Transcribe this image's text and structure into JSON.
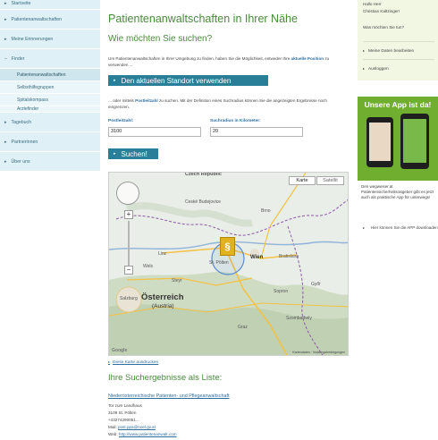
{
  "sidebar": {
    "items": [
      {
        "label": "Startseite",
        "arrow": "▸"
      },
      {
        "label": "Patientenanwaltschaften",
        "arrow": "▸"
      },
      {
        "label": "Meine Erinnerungen",
        "arrow": "▸"
      },
      {
        "label": "Finder",
        "arrow": "–"
      }
    ],
    "subitems": [
      {
        "label": "Patientenanwaltschaften"
      },
      {
        "label": "Selbsthilfegruppen"
      },
      {
        "label": "Spitalskompass"
      },
      {
        "label": "Ärztefinder"
      }
    ],
    "items_after": [
      {
        "label": "Tagebuch",
        "arrow": "▸"
      },
      {
        "label": "Partnerinnen",
        "arrow": "▸"
      },
      {
        "label": "Über uns",
        "arrow": "▸"
      }
    ]
  },
  "main": {
    "title": "Patientenanwaltschaften in Ihrer Nähe",
    "subtitle": "Wie möchten Sie suchen?",
    "intro_pre": "Um Patientenanwaltschaften in Ihrer Umgebung zu finden, haben Sie die Möglichkeit, entweder Ihre",
    "intro_bold": "aktuelle Position",
    "intro_post": "zu verwenden ...",
    "location_button": "Den aktuellen Standort verwenden",
    "intro2_pre": "... oder mittels",
    "intro2_bold": "Postleitzahl",
    "intro2_post": "zu suchen. Mit der Definition eines Suchradius können Sie die angezeigten Ergebnisse noch eingrenzen.",
    "postcode_label": "Postleitzahl:",
    "postcode_value": "3100",
    "radius_label": "Suchradius in Kilometer:",
    "radius_value": "20",
    "search_button": "Suchen!",
    "arrow": "▸"
  },
  "map": {
    "type_buttons": [
      "Karte",
      "Satellit"
    ],
    "country": "Österreich",
    "country_sub": "(Austria)",
    "country_north": "Czech Republic",
    "cities": [
      "Wien",
      "Bratislava",
      "St. Pölten",
      "Linz",
      "Graz",
      "Salzburg",
      "Szombathely",
      "Győr",
      "Brno",
      "Ceské Budejovice",
      "Sopron",
      "Steyr",
      "Wels"
    ],
    "marker_symbol": "§",
    "footer": "Kartendaten · Nutzungsbedingungen",
    "logo": "Google",
    "open_link": "Diese Karte ausdrucken"
  },
  "results": {
    "title": "Ihre Suchergebnisse als Liste:",
    "name": "Niederösterreichische Patienten- und Pflegeanwaltschaft",
    "lines": [
      "Tor zum Landhaus",
      "3109 St. Pölten",
      "+43274290051..."
    ],
    "mail_label": "Mail:",
    "mail": "post.ppa@noel.gv.at",
    "web_label": "Web:",
    "web": "http://www.patientenanwalt.com"
  },
  "right": {
    "greeting": "Hallo Herr",
    "user": "Christian Kaltzinger!",
    "question": "Was möchten Sie tun?",
    "links": [
      "Meine Daten bearbeiten",
      "Ausloggen"
    ],
    "app_header": "Unsere App ist da!",
    "app_text": "Den wegweiser.at Patientensicherheitsratgeber gibt es jetzt auch als praktische App für unterwegs!",
    "app_link": "Hier können Sie die APP downloaden"
  }
}
